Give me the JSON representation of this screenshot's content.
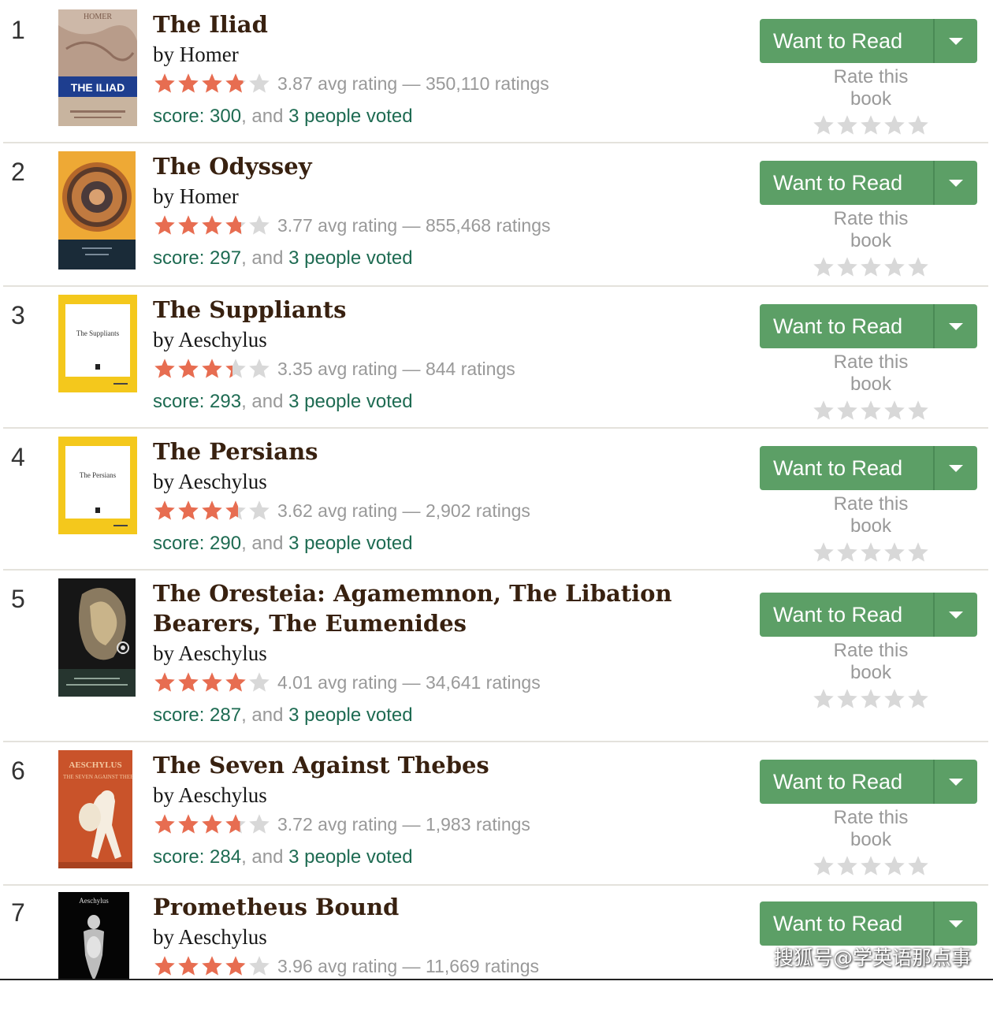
{
  "books": [
    {
      "rank": "1",
      "title": "The Iliad",
      "by": "by",
      "author": "Homer",
      "rating_num": 3.87,
      "rating_text": "3.87 avg rating — 350,110 ratings",
      "score_label": "score: 300",
      "mid": ", and ",
      "voters": "3 people voted",
      "cover": "iliad-cover"
    },
    {
      "rank": "2",
      "title": "The Odyssey",
      "by": "by",
      "author": "Homer",
      "rating_num": 3.77,
      "rating_text": "3.77 avg rating — 855,468 ratings",
      "score_label": "score: 297",
      "mid": ", and ",
      "voters": "3 people voted",
      "cover": "odyssey-cover"
    },
    {
      "rank": "3",
      "title": "The Suppliants",
      "by": "by",
      "author": "Aeschylus",
      "rating_num": 3.35,
      "rating_text": "3.35 avg rating — 844 ratings",
      "score_label": "score: 293",
      "mid": ", and ",
      "voters": "3 people voted",
      "cover": "suppliants-cover"
    },
    {
      "rank": "4",
      "title": "The Persians",
      "by": "by",
      "author": "Aeschylus",
      "rating_num": 3.62,
      "rating_text": "3.62 avg rating — 2,902 ratings",
      "score_label": "score: 290",
      "mid": ", and ",
      "voters": "3 people voted",
      "cover": "persians-cover"
    },
    {
      "rank": "5",
      "title": "The Oresteia: Agamemnon, The Libation Bearers, The Eumenides",
      "by": "by",
      "author": "Aeschylus",
      "rating_num": 4.01,
      "rating_text": "4.01 avg rating — 34,641 ratings",
      "score_label": "score: 287",
      "mid": ", and ",
      "voters": "3 people voted",
      "cover": "oresteia-cover"
    },
    {
      "rank": "6",
      "title": "The Seven Against Thebes",
      "by": "by",
      "author": "Aeschylus",
      "rating_num": 3.72,
      "rating_text": "3.72 avg rating — 1,983 ratings",
      "score_label": "score: 284",
      "mid": ", and ",
      "voters": "3 people voted",
      "cover": "seven-cover"
    },
    {
      "rank": "7",
      "title": "Prometheus Bound",
      "by": "by",
      "author": "Aeschylus",
      "rating_num": 3.96,
      "rating_text": "3.96 avg rating — 11,669 ratings",
      "score_label": "",
      "mid": "",
      "voters": "",
      "cover": "prometheus-cover"
    }
  ],
  "cover_text": {
    "iliad_band": "THE ILIAD",
    "iliad_top": "HOMER",
    "suppliants": "The Suppliants",
    "persians": "The Persians",
    "seven": "AESCHYLUS",
    "seven_sub": "THE SEVEN AGAINST THEBES",
    "prometheus": "Aeschylus"
  },
  "want_to_read": "Want to Read",
  "rate_this_book": "Rate this book",
  "watermark": "搜狐号@学英语那点事",
  "colors": {
    "star_filled": "#e76d51",
    "star_empty": "#d8d8d8",
    "button": "#5c9f66",
    "title": "#382110",
    "link": "#1e6b52"
  }
}
